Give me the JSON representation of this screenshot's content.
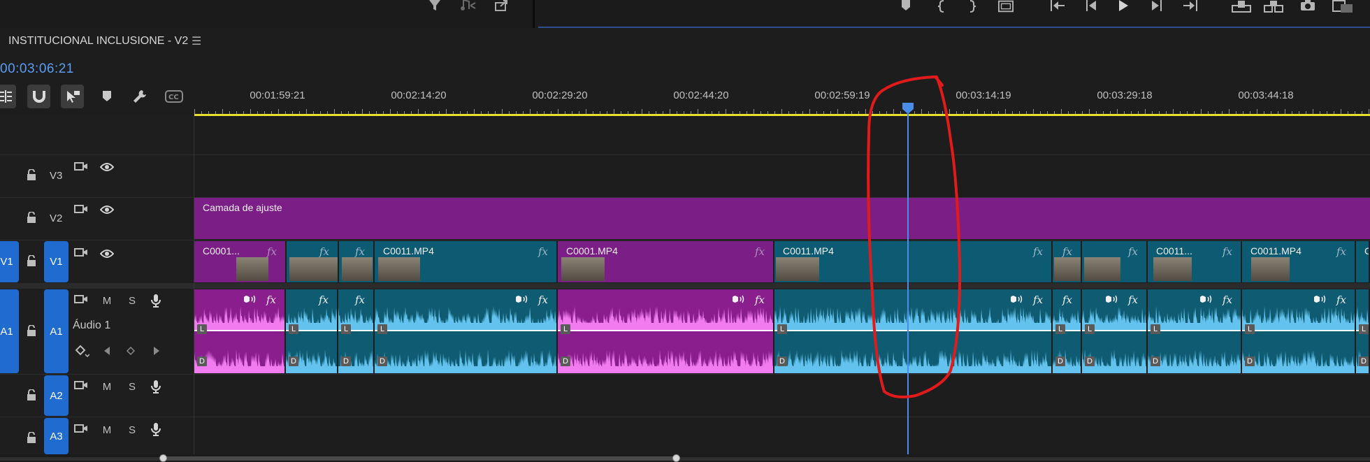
{
  "sequence": {
    "title": "INSTITUCIONAL INCLUSIONE - V2",
    "menu_icon": "hamburger-menu-icon",
    "timecode": "00:03:06:21"
  },
  "ruler": {
    "labels": [
      "00:01:59:21",
      "00:02:14:20",
      "00:02:29:20",
      "00:02:44:20",
      "00:02:59:19",
      "00:03:14:19",
      "00:03:29:18",
      "00:03:44:18"
    ]
  },
  "tracks": {
    "v3": {
      "label": "V3"
    },
    "v2": {
      "label": "V2"
    },
    "v1": {
      "label": "V1",
      "source_label": "V1"
    },
    "a1": {
      "label": "A1",
      "source_label": "A1",
      "name": "Áudio 1",
      "mute": "M",
      "solo": "S"
    },
    "a2": {
      "label": "A2",
      "mute": "M",
      "solo": "S"
    },
    "a3": {
      "label": "A3",
      "mute": "M",
      "solo": "S"
    }
  },
  "clips": {
    "adjustment": {
      "name": "Camada de ajuste"
    },
    "v1": [
      {
        "name": "C0001...",
        "color": "purple"
      },
      {
        "name": "",
        "color": "teal"
      },
      {
        "name": "",
        "color": "teal"
      },
      {
        "name": "C0011.MP4",
        "color": "teal"
      },
      {
        "name": "C0001.MP4",
        "color": "purple"
      },
      {
        "name": "C0011.MP4",
        "color": "teal"
      },
      {
        "name": "",
        "color": "teal"
      },
      {
        "name": "",
        "color": "teal"
      },
      {
        "name": "C0011...",
        "color": "teal"
      },
      {
        "name": "C0011.MP4",
        "color": "teal"
      },
      {
        "name": "C",
        "color": "teal"
      }
    ],
    "fx_label": "fx",
    "channel_left": "L",
    "channel_right": "D"
  },
  "colors": {
    "accent_blue": "#1f6bd0",
    "timecode_blue": "#5b9df5",
    "work_area_yellow": "#e6e02a",
    "clip_purple": "#7b1f86",
    "clip_teal": "#0d5a73",
    "audio_pink": "#f07cf0",
    "audio_cyan": "#63c3ee",
    "annotation_red": "#e11b1b"
  }
}
